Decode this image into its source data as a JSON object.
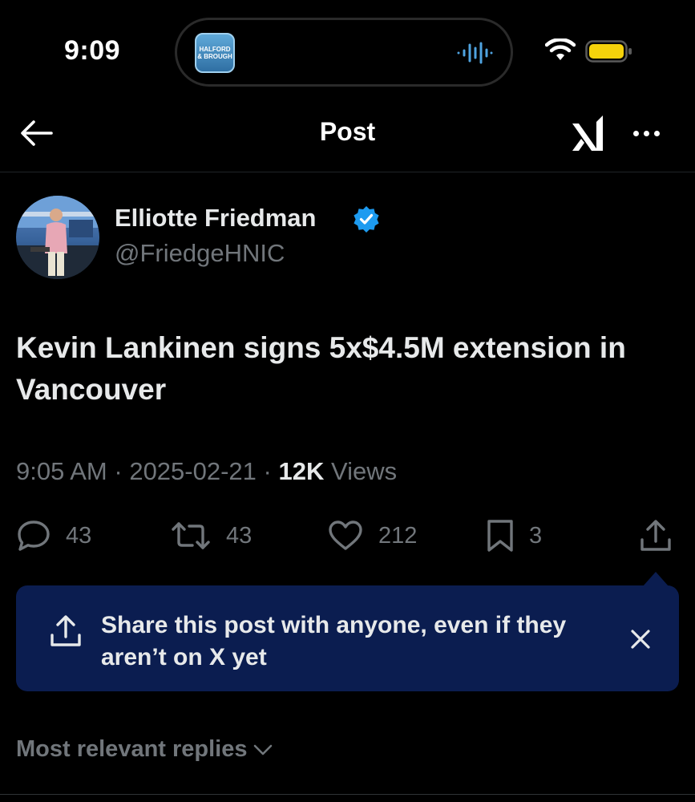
{
  "status_bar": {
    "time": "9:09",
    "live_activity_app_label": "HALFORD & BROUGH"
  },
  "header": {
    "title": "Post",
    "back_icon": "arrow-left-icon",
    "grok_icon": "grok-icon",
    "more_icon": "more-horizontal-icon"
  },
  "author": {
    "display_name": "Elliotte Friedman",
    "handle": "@FriedgeHNIC",
    "verified": true,
    "verified_color": "#1d9bf0"
  },
  "tweet": {
    "text": "Kevin Lankinen signs 5x$4.5M extension in Vancouver",
    "time": "9:05 AM",
    "separator": "·",
    "date": "2025-02-21",
    "views_count": "12K",
    "views_label": "Views"
  },
  "actions": {
    "replies": "43",
    "reposts": "43",
    "likes": "212",
    "bookmarks": "3"
  },
  "share_prompt": {
    "text": "Share this post with anyone, even if they aren’t on X yet",
    "background": "#0b1d50"
  },
  "replies": {
    "sort_label": "Most relevant replies"
  },
  "colors": {
    "background": "#000000",
    "primary_text": "#e7e9ea",
    "secondary_text": "#71767b"
  }
}
